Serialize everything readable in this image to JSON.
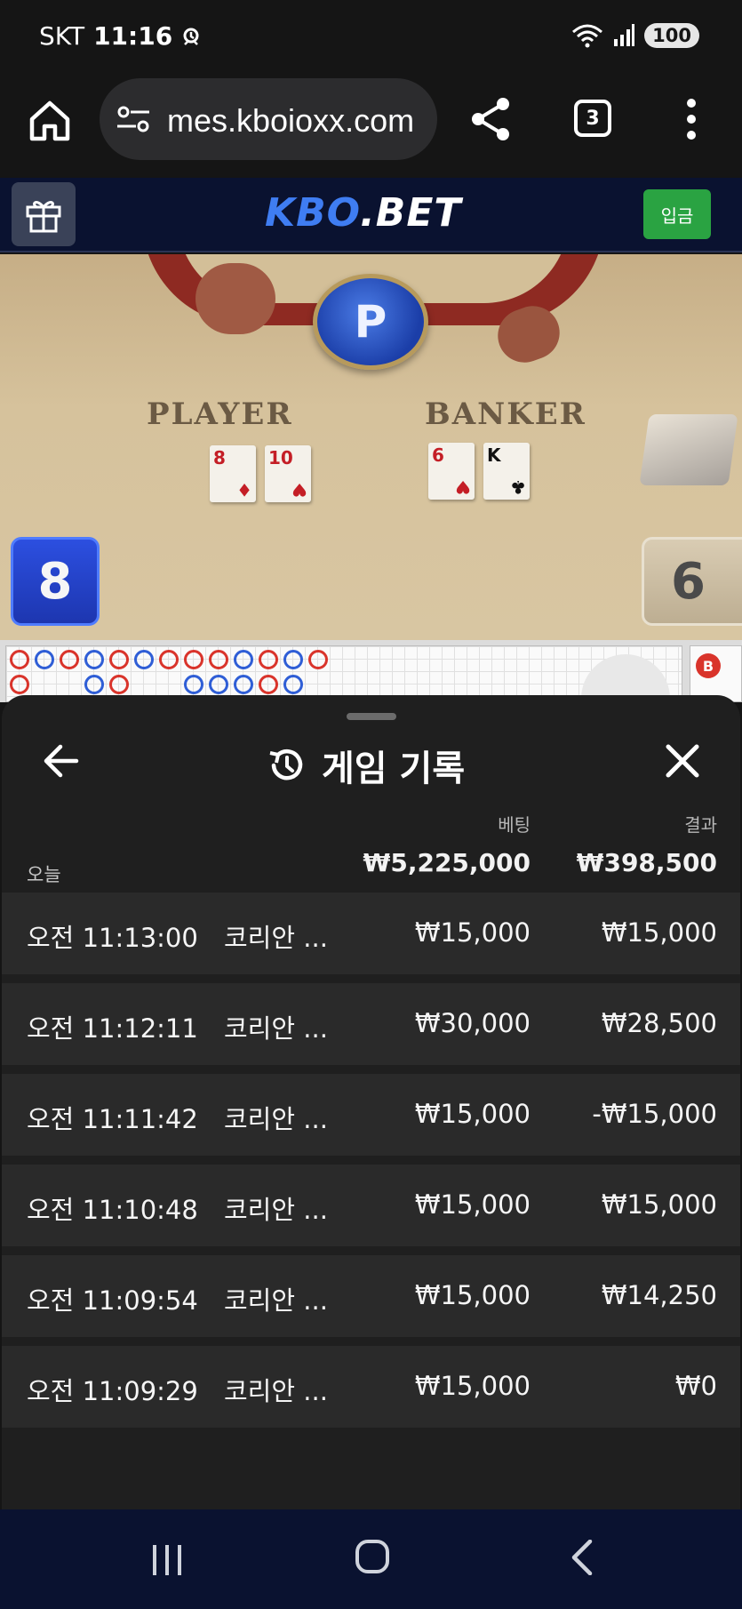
{
  "status_bar": {
    "carrier": "SKT",
    "time": "11:16",
    "battery": "100"
  },
  "browser": {
    "url": "mes.kboioxx.com",
    "tab_count": "3"
  },
  "site_header": {
    "logo_kbo": "KBO",
    "logo_bet": ".BET",
    "deposit_label": "입금"
  },
  "game": {
    "winner_badge": "P",
    "player_label": "PLAYER",
    "banker_label": "BANKER",
    "player_score": "8",
    "banker_score": "6",
    "player_cards": [
      {
        "rank": "8",
        "suit": "♦"
      },
      {
        "rank": "10",
        "suit": "♥"
      }
    ],
    "banker_cards": [
      {
        "rank": "6",
        "suit": "♥"
      },
      {
        "rank": "K",
        "suit": "♣"
      }
    ],
    "roadmap_side_label": "B"
  },
  "history": {
    "title": "게임 기록",
    "col_bet": "베팅",
    "col_result": "결과",
    "day_label": "오늘",
    "total_bet": "₩5,225,000",
    "total_result": "₩398,500",
    "rows": [
      {
        "time": "오전 11:13:00",
        "game": "코리안 ...",
        "bet": "₩15,000",
        "result": "₩15,000"
      },
      {
        "time": "오전 11:12:11",
        "game": "코리안 ...",
        "bet": "₩30,000",
        "result": "₩28,500"
      },
      {
        "time": "오전 11:11:42",
        "game": "코리안 ...",
        "bet": "₩15,000",
        "result": "-₩15,000"
      },
      {
        "time": "오전 11:10:48",
        "game": "코리안 ...",
        "bet": "₩15,000",
        "result": "₩15,000"
      },
      {
        "time": "오전 11:09:54",
        "game": "코리안 ...",
        "bet": "₩15,000",
        "result": "₩14,250"
      },
      {
        "time": "오전 11:09:29",
        "game": "코리안 ...",
        "bet": "₩15,000",
        "result": "₩0"
      }
    ]
  },
  "colors": {
    "sheet_bg": "#1f1f1f",
    "row_bg": "#2a2a2a",
    "header_bg": "#0a1230",
    "deposit_green": "#2aa342",
    "logo_blue": "#3f7df2"
  },
  "icons": [
    "home-icon",
    "tune-icon",
    "share-icon",
    "more-vert-icon",
    "gift-icon",
    "back-arrow-icon",
    "history-icon",
    "close-icon",
    "recent-apps-icon",
    "nav-home-icon",
    "nav-back-icon",
    "wifi-icon",
    "signal-icon",
    "alarm-icon"
  ]
}
